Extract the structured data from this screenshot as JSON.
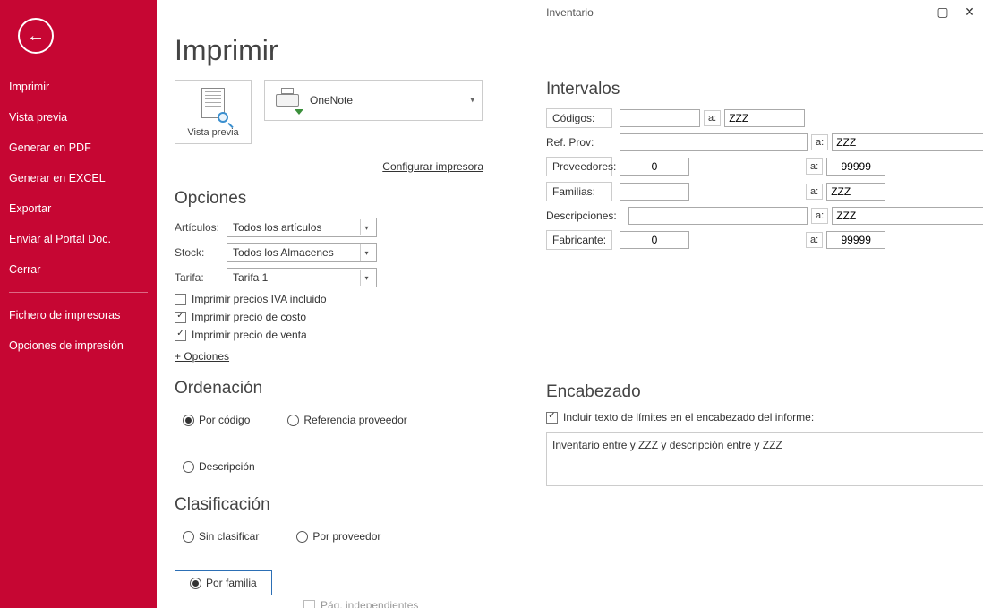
{
  "window": {
    "title": "Inventario"
  },
  "sidebar": {
    "items": [
      "Imprimir",
      "Vista previa",
      "Generar en PDF",
      "Generar en EXCEL",
      "Exportar",
      "Enviar al Portal Doc.",
      "Cerrar"
    ],
    "group2": [
      "Fichero de impresoras",
      "Opciones de impresión"
    ]
  },
  "page_title": "Imprimir",
  "preview_tile_label": "Vista previa",
  "printer_selected": "OneNote",
  "configure_printer": "Configurar impresora",
  "sections": {
    "opciones": "Opciones",
    "ordenacion": "Ordenación",
    "clasificacion": "Clasificación",
    "intervalos": "Intervalos",
    "encabezado": "Encabezado"
  },
  "opciones": {
    "labels": {
      "articulos": "Artículos:",
      "stock": "Stock:",
      "tarifa": "Tarifa:"
    },
    "articulos_value": "Todos los artículos",
    "stock_value": "Todos los Almacenes",
    "tarifa_value": "Tarifa 1",
    "cb_iva": "Imprimir precios IVA incluido",
    "cb_costo": "Imprimir precio de costo",
    "cb_venta": "Imprimir precio de venta",
    "mas_opciones": "+ Opciones"
  },
  "ordenacion": {
    "por_codigo": "Por código",
    "ref_proveedor": "Referencia proveedor",
    "descripcion": "Descripción"
  },
  "clasificacion": {
    "sin_clasificar": "Sin clasificar",
    "por_proveedor": "Por proveedor",
    "por_familia": "Por familia",
    "pag_indep": "Pág. independientes"
  },
  "intervalos": {
    "labels": {
      "codigos": "Códigos:",
      "ref_prov": "Ref. Prov:",
      "proveedores": "Proveedores:",
      "familias": "Familias:",
      "descripciones": "Descripciones:",
      "fabricante": "Fabricante:",
      "a": "a:"
    },
    "values": {
      "codigos_from": "",
      "codigos_to": "ZZZ",
      "ref_from": "",
      "ref_to": "ZZZ",
      "prov_from": "0",
      "prov_to": "99999",
      "fam_from": "",
      "fam_to": "ZZZ",
      "desc_from": "",
      "desc_to": "ZZZ",
      "fab_from": "0",
      "fab_to": "99999"
    }
  },
  "encabezado": {
    "cb_label": "Incluir texto de límites en el encabezado del informe:",
    "text": "Inventario entre  y ZZZ y descripción entre  y ZZZ"
  }
}
